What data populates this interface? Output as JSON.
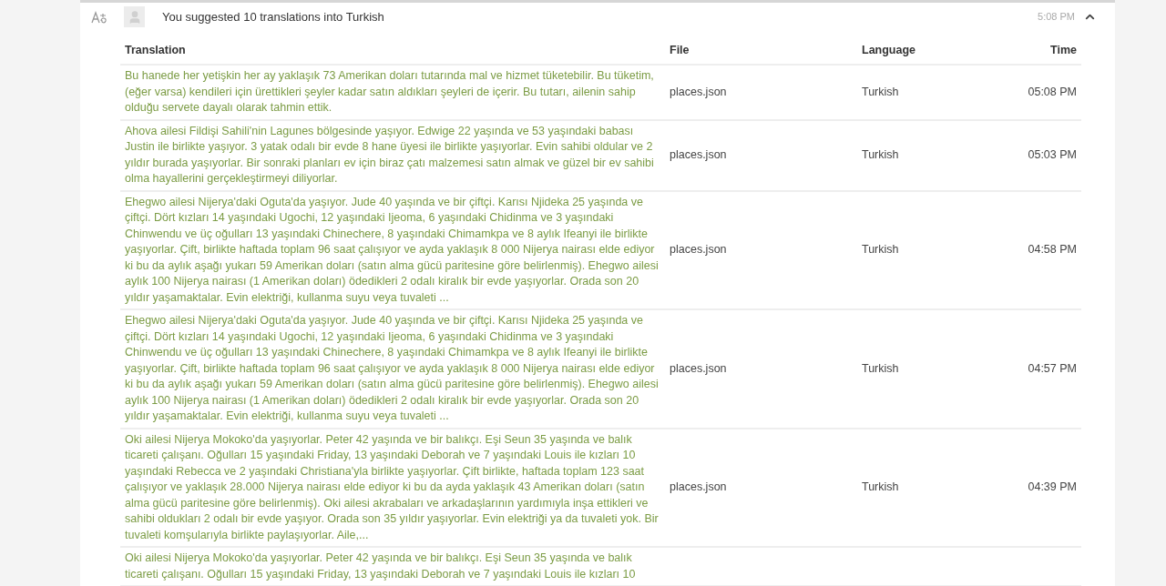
{
  "activity": {
    "title": "You suggested 10 translations into Turkish",
    "time": "5:08 PM",
    "expanded": true
  },
  "table": {
    "columns": [
      "Translation",
      "File",
      "Language",
      "Time"
    ],
    "rows": [
      {
        "translation": "Bu hanede her yetişkin her ay yaklaşık 73 Amerikan doları tutarında mal ve hizmet tüketebilir. Bu tüketim, (eğer varsa) kendileri için ürettikleri şeyler kadar satın aldıkları şeyleri de içerir. Bu tutarı, ailenin sahip olduğu servete dayalı olarak tahmin ettik.",
        "file": "places.json",
        "language": "Turkish",
        "time": "05:08 PM"
      },
      {
        "translation": "Ahova ailesi Fildişi Sahili'nin Lagunes bölgesinde yaşıyor. Edwige 22 yaşında ve 53 yaşındaki babası Justin ile birlikte yaşıyor. 3 yatak odalı bir evde 8 hane üyesi ile birlikte yaşıyorlar. Evin sahibi oldular ve 2 yıldır burada yaşıyorlar. Bir sonraki planları ev için biraz çatı malzemesi satın almak ve güzel bir ev sahibi olma hayallerini gerçekleştirmeyi diliyorlar.",
        "file": "places.json",
        "language": "Turkish",
        "time": "05:03 PM"
      },
      {
        "translation": "Ehegwo ailesi Nijerya'daki Oguta'da yaşıyor. Jude 40 yaşında ve bir çiftçi. Karısı Njideka 25 yaşında ve çiftçi. Dört kızları 14 yaşındaki Ugochi, 12 yaşındaki Ijeoma, 6 yaşındaki Chidinma ve 3 yaşındaki Chinwendu ve üç oğulları 13 yaşındaki Chinechere, 8 yaşındaki Chimamkpa ve 8 aylık Ifeanyi ile birlikte yaşıyorlar. Çift, birlikte haftada toplam 96 saat çalışıyor ve ayda yaklaşık 8 000 Nijerya nairası elde ediyor ki bu da aylık aşağı yukarı 59 Amerikan doları (satın alma gücü paritesine göre belirlenmiş). Ehegwo ailesi aylık 100 Nijerya nairası (1 Amerikan doları) ödedikleri 2 odalı kiralık bir evde yaşıyorlar. Orada son 20 yıldır yaşamaktalar. Evin elektriği, kullanma suyu veya tuvaleti ...",
        "file": "places.json",
        "language": "Turkish",
        "time": "04:58 PM"
      },
      {
        "translation": "Ehegwo ailesi Nijerya'daki Oguta'da yaşıyor. Jude 40 yaşında ve bir çiftçi. Karısı Njideka 25 yaşında ve çiftçi. Dört kızları 14 yaşındaki Ugochi, 12 yaşındaki Ijeoma, 6 yaşındaki Chidinma ve 3 yaşındaki Chinwendu ve üç oğulları 13 yaşındaki Chinechere, 8 yaşındaki Chimamkpa ve 8 aylık Ifeanyi ile birlikte yaşıyorlar. Çift, birlikte haftada toplam 96 saat çalışıyor ve ayda yaklaşık 8 000 Nijerya nairası elde ediyor ki bu da aylık aşağı yukarı 59 Amerikan doları (satın alma gücü paritesine göre belirlenmiş). Ehegwo ailesi aylık 100 Nijerya nairası (1 Amerikan doları) ödedikleri 2 odalı kiralık bir evde yaşıyorlar. Orada son 20 yıldır yaşamaktalar. Evin elektriği, kullanma suyu veya tuvaleti ...",
        "file": "places.json",
        "language": "Turkish",
        "time": "04:57 PM"
      },
      {
        "translation": "Oki ailesi Nijerya Mokoko'da yaşıyorlar. Peter 42 yaşında ve bir balıkçı. Eşi Seun 35 yaşında ve balık ticareti çalışanı. Oğulları 15 yaşındaki Friday, 13 yaşındaki Deborah ve 7 yaşındaki Louis ile kızları 10 yaşındaki Rebecca ve 2 yaşındaki Christiana'yla birlikte yaşıyorlar. Çift birlikte, haftada toplam 123 saat çalışıyor ve yaklaşık 28.000 Nijerya nairası elde ediyor ki bu da ayda yaklaşık 43 Amerikan doları (satın alma gücü paritesine göre belirlenmiş). Oki ailesi akrabaları ve arkadaşlarının yardımıyla inşa ettikleri ve sahibi oldukları 2 odalı bir evde yaşıyor. Orada son 35 yıldır yaşıyorlar. Evin elektriği ya da tuvaleti yok. Bir tuvaleti komşularıyla birlikte paylaşıyorlar. Aile,...",
        "file": "places.json",
        "language": "Turkish",
        "time": "04:39 PM"
      },
      {
        "translation": "Oki ailesi Nijerya Mokoko'da yaşıyorlar. Peter 42 yaşında ve bir balıkçı. Eşi Seun 35 yaşında ve balık ticareti çalışanı. Oğulları 15 yaşındaki Friday, 13 yaşındaki Deborah ve 7 yaşındaki Louis ile kızları 10"
      }
    ]
  }
}
